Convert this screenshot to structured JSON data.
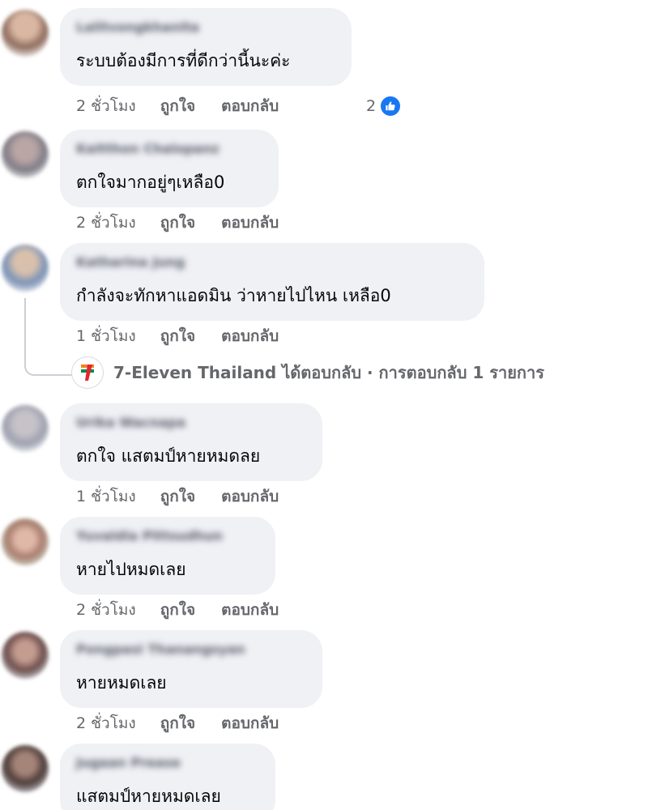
{
  "comments": [
    {
      "author": "Lalitvongkhanita",
      "text": "ระบบต้องมีการที่ดีกว่านี้นะค่ะ",
      "time": "2 ชั่วโมง",
      "like": "ถูกใจ",
      "reply": "ตอบกลับ",
      "reaction_count": "2",
      "avatar_color": "#b58f7a"
    },
    {
      "author": "Kaitthon Chalopanz",
      "text": "ตกใจมากอยู่ๆเหลือ0",
      "time": "2 ชั่วโมง",
      "like": "ถูกใจ",
      "reply": "ตอบกลับ",
      "avatar_color": "#a9a3a8"
    },
    {
      "author": "Katharina Jung",
      "text": "กำลังจะทักหาแอดมิน ว่าหายไปไหน เหลือ0",
      "time": "1 ชั่วโมง",
      "like": "ถูกใจ",
      "reply": "ตอบกลับ",
      "avatar_color": "#8f9fb8"
    },
    {
      "author": "Urika Wacnapa",
      "text": "ตกใจ แสตมป์หายหมดลย",
      "time": "1 ชั่วโมง",
      "like": "ถูกใจ",
      "reply": "ตอบกลับ",
      "avatar_color": "#c7c9d3"
    },
    {
      "author": "Yuvaldia Pittsudhun",
      "text": "หายไปหมดเลย",
      "time": "2 ชั่วโมง",
      "like": "ถูกใจ",
      "reply": "ตอบกลับ",
      "avatar_color": "#c99b8d"
    },
    {
      "author": "Pongpasi Thanangsyan",
      "text": "หายหมดเลย",
      "time": "2 ชั่วโมง",
      "like": "ถูกใจ",
      "reply": "ตอบกลับ",
      "avatar_color": "#8b6e6b"
    },
    {
      "author": "Jugaan Prease",
      "text": "แสตมป์หายหมดเลย",
      "avatar_color": "#5b4a45"
    }
  ],
  "page_reply": {
    "logo_text": "7",
    "logo_sub": "ELEVEN",
    "page_name": "7-Eleven Thailand",
    "text": "ได้ตอบกลับ · การตอบกลับ 1 รายการ",
    "brand_green": "#008c45",
    "brand_orange": "#f58220",
    "brand_red": "#e3262f"
  },
  "colors": {
    "bubble_bg": "#eff1f5",
    "meta_text": "#65676b",
    "like_blue": "#1877f2"
  }
}
